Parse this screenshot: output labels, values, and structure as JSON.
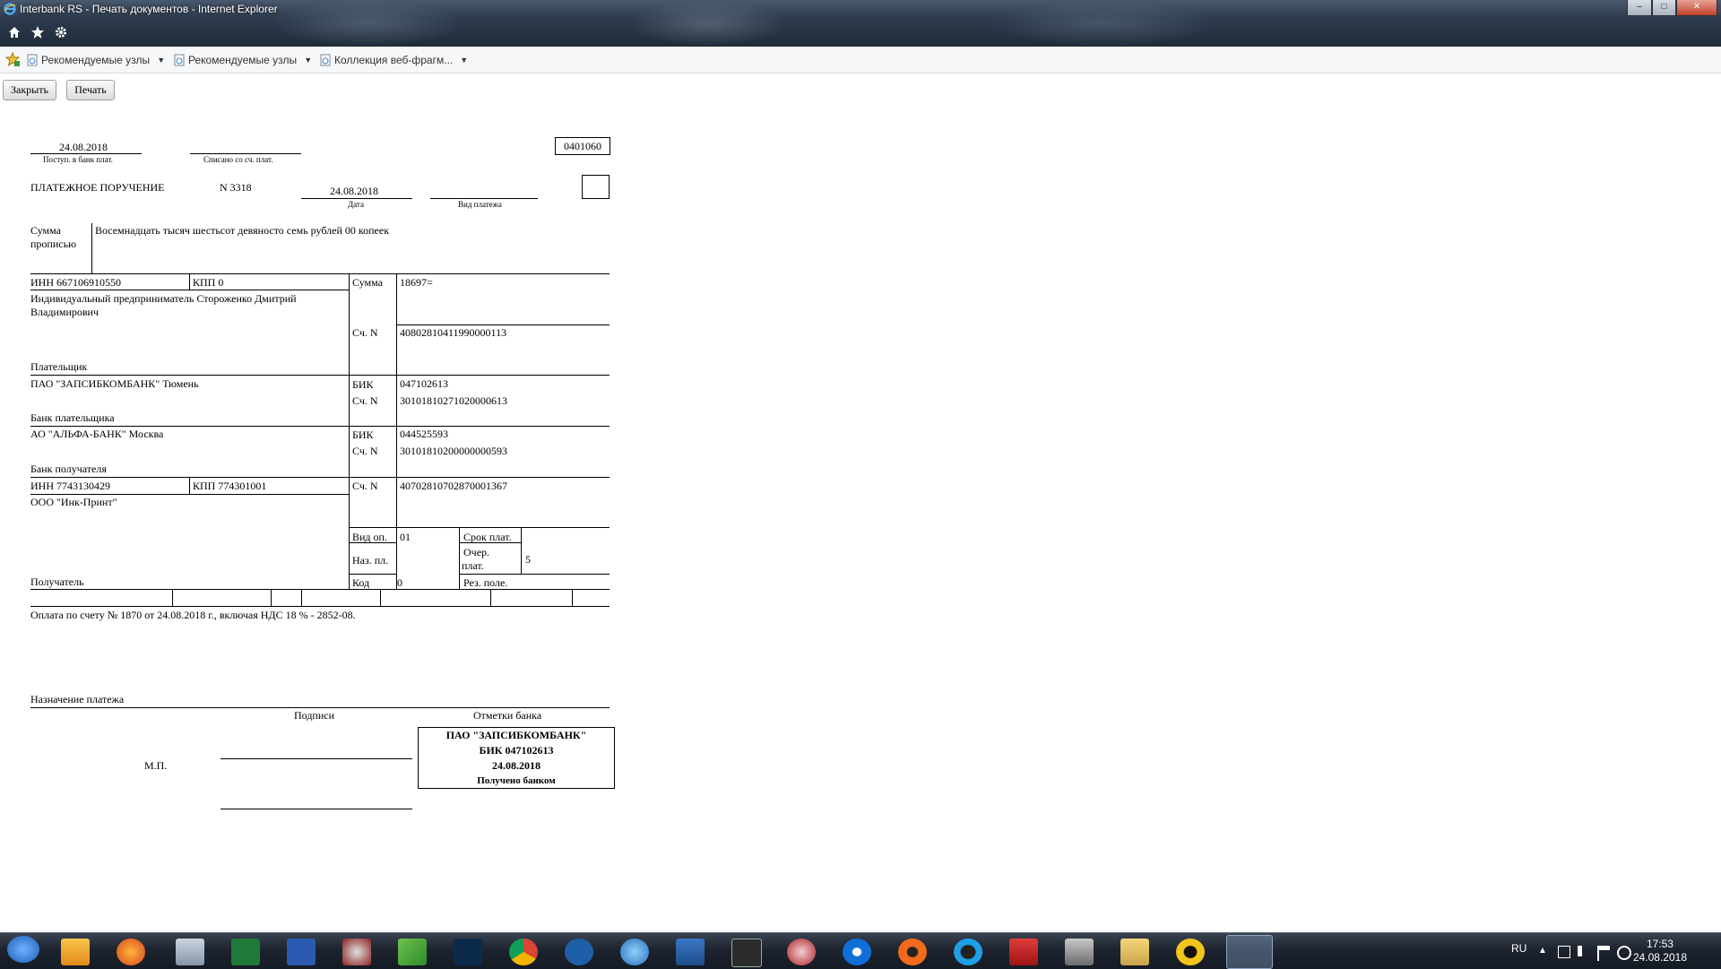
{
  "window": {
    "title": "Interbank RS - Печать документов - Internet Explorer"
  },
  "favorites": [
    {
      "label": "Рекомендуемые узлы"
    },
    {
      "label": "Рекомендуемые узлы"
    },
    {
      "label": "Коллекция веб-фрагм..."
    }
  ],
  "toolbar": {
    "close_label": "Закрыть",
    "print_label": "Печать"
  },
  "doc": {
    "form_code": "0401060",
    "received_date": "24.08.2018",
    "received_caption": "Поступ. в банк плат.",
    "debited_caption": "Списано со сч. плат.",
    "title": "ПЛАТЕЖНОЕ ПОРУЧЕНИЕ",
    "number": "N 3318",
    "date": "24.08.2018",
    "date_caption": "Дата",
    "payment_type_caption": "Вид платежа",
    "amount_words_label_1": "Сумма",
    "amount_words_label_2": "прописью",
    "amount_words": "Восемнадцать тысяч шестьсот девяносто семь рублей 00 копеек",
    "payer": {
      "inn": "ИНН 667106910550",
      "kpp": "КПП  0",
      "name_line1": "Индивидуальный предприниматель Стороженко Дмитрий",
      "name_line2": "Владимирович",
      "caption": "Плательщик"
    },
    "amount_label": "Сумма",
    "amount": "18697=",
    "account_label": "Сч. N",
    "payer_account": "40802810411990000113",
    "payer_bank": {
      "name": "ПАО \"ЗАПСИБКОМБАНК\"  Тюмень",
      "caption": "Банк плательщика",
      "bik_label": "БИК",
      "bik": "047102613",
      "acc_label": "Сч. N",
      "acc": "30101810271020000613"
    },
    "payee_bank": {
      "name": "АО \"АЛЬФА-БАНК\"  Москва",
      "caption": "Банк получателя",
      "bik_label": "БИК",
      "bik": "044525593",
      "acc_label": "Сч. N",
      "acc": "30101810200000000593"
    },
    "payee": {
      "inn": "ИНН 7743130429",
      "kpp": "КПП 774301001",
      "name": "ООО \"Инк-Принт\"",
      "caption": "Получатель",
      "acc_label": "Сч. N",
      "acc": "40702810702870001367"
    },
    "op_type_label": "Вид оп.",
    "op_type": "01",
    "due_label": "Срок плат.",
    "purpose_code_label": "Наз. пл.",
    "priority_label_1": "Очер.",
    "priority_label_2": "плат.",
    "priority": "5",
    "code_label": "Код",
    "code": "0",
    "reserve_label": "Рез. поле.",
    "purpose_text": "Оплата по счету № 1870 от 24.08.2018 г., включая НДС 18 % - 2852-08.",
    "purpose_caption": "Назначение платежа",
    "signatures_caption": "Подписи",
    "bank_marks_caption": "Отметки банка",
    "stamp_place": "М.П.",
    "stamp": {
      "line1": "ПАО \"ЗАПСИБКОМБАНК\"",
      "line2": "БИК 047102613",
      "line3": "24.08.2018",
      "line4": "Получено банком"
    }
  },
  "taskbar": {
    "language": "RU",
    "time": "17:53",
    "date": "24.08.2018",
    "apps": [
      "start",
      "outlook",
      "firefox",
      "calculator",
      "excel",
      "word",
      "snipping-tool",
      "green-app",
      "photoshop",
      "chrome",
      "arrow-app",
      "globe-app",
      "camera-app",
      "lightroom",
      "gift-app",
      "teamviewer",
      "origin",
      "qt-app",
      "autocad",
      "m-app",
      "folder",
      "warning-app",
      "internet-explorer"
    ]
  }
}
